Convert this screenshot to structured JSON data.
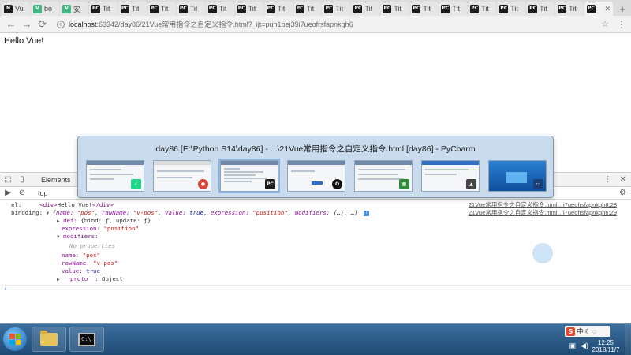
{
  "browser": {
    "tabs": [
      {
        "icon": "N",
        "title": "Vu"
      },
      {
        "icon": "V",
        "title": "bo"
      },
      {
        "icon": "V",
        "title": "安"
      },
      {
        "icon": "PC",
        "title": "Tit"
      },
      {
        "icon": "PC",
        "title": "Tit"
      },
      {
        "icon": "PC",
        "title": "Tit"
      },
      {
        "icon": "PC",
        "title": "Tit"
      },
      {
        "icon": "PC",
        "title": "Tit"
      },
      {
        "icon": "PC",
        "title": "Tit"
      },
      {
        "icon": "PC",
        "title": "Tit"
      },
      {
        "icon": "PC",
        "title": "Tit"
      },
      {
        "icon": "PC",
        "title": "Tit"
      },
      {
        "icon": "PC",
        "title": "Tit"
      },
      {
        "icon": "PC",
        "title": "Tit"
      },
      {
        "icon": "PC",
        "title": "Tit"
      },
      {
        "icon": "PC",
        "title": "Tit"
      },
      {
        "icon": "PC",
        "title": "Tit"
      },
      {
        "icon": "PC",
        "title": "Tit"
      },
      {
        "icon": "PC",
        "title": "Tit"
      },
      {
        "icon": "PC",
        "title": "Tit"
      },
      {
        "icon": "PC",
        "title": "",
        "active": true
      }
    ],
    "url_host": "localhost",
    "url_path": ":63342/day86/21Vue常用指令之自定义指令.html?_ijt=puh1bej39i7ueofrsfapnkgh6"
  },
  "page": {
    "text": "Hello Vue!"
  },
  "devtools": {
    "tab_elements": "Elements",
    "context": "top",
    "rows": {
      "el_label": "el:",
      "el_open": "<div>",
      "el_text": "Hello Vue!",
      "el_close": "</div>",
      "el_src": "21Vue常用指令之自定义指令.html…i7ueofrsfapnkgh6:28",
      "binding_label": "bindding:",
      "binding_src": "21Vue常用指令之自定义指令.html…i7ueofrsfapnkgh6:29",
      "binding_open": "{",
      "binding_name_key": "name:",
      "binding_name_val": "\"pos\"",
      "binding_raw_key": "rawName:",
      "binding_raw_val": "\"v-pos\"",
      "binding_value_key": "value:",
      "binding_value_val": "true",
      "binding_expr_key": "expression:",
      "binding_expr_val": "\"position\"",
      "binding_mod_key": "modifiers:",
      "binding_mod_val": "{…}",
      "binding_close": ", …}",
      "def_key": "def:",
      "def_val": "{bind: ƒ, update: ƒ}",
      "expression_key": "expression:",
      "expression_val": "\"position\"",
      "modifiers_key": "modifiers:",
      "no_props": "No properties",
      "name_key": "name:",
      "name_val": "\"pos\"",
      "rawname_key": "rawName:",
      "rawname_val": "\"v-pos\"",
      "value_key": "value:",
      "value_val": "true",
      "proto_key": "__proto__:",
      "proto_val": "Object",
      "prompt": "›"
    }
  },
  "thumbnail_popup": {
    "title": "day86 [E:\\Python S14\\day86] - ...\\21Vue常用指令之自定义指令.html [day86] - PyCharm"
  },
  "taskbar": {
    "ime_zh": "中",
    "clock_time": "12:25",
    "clock_date": "2018/11/7"
  }
}
